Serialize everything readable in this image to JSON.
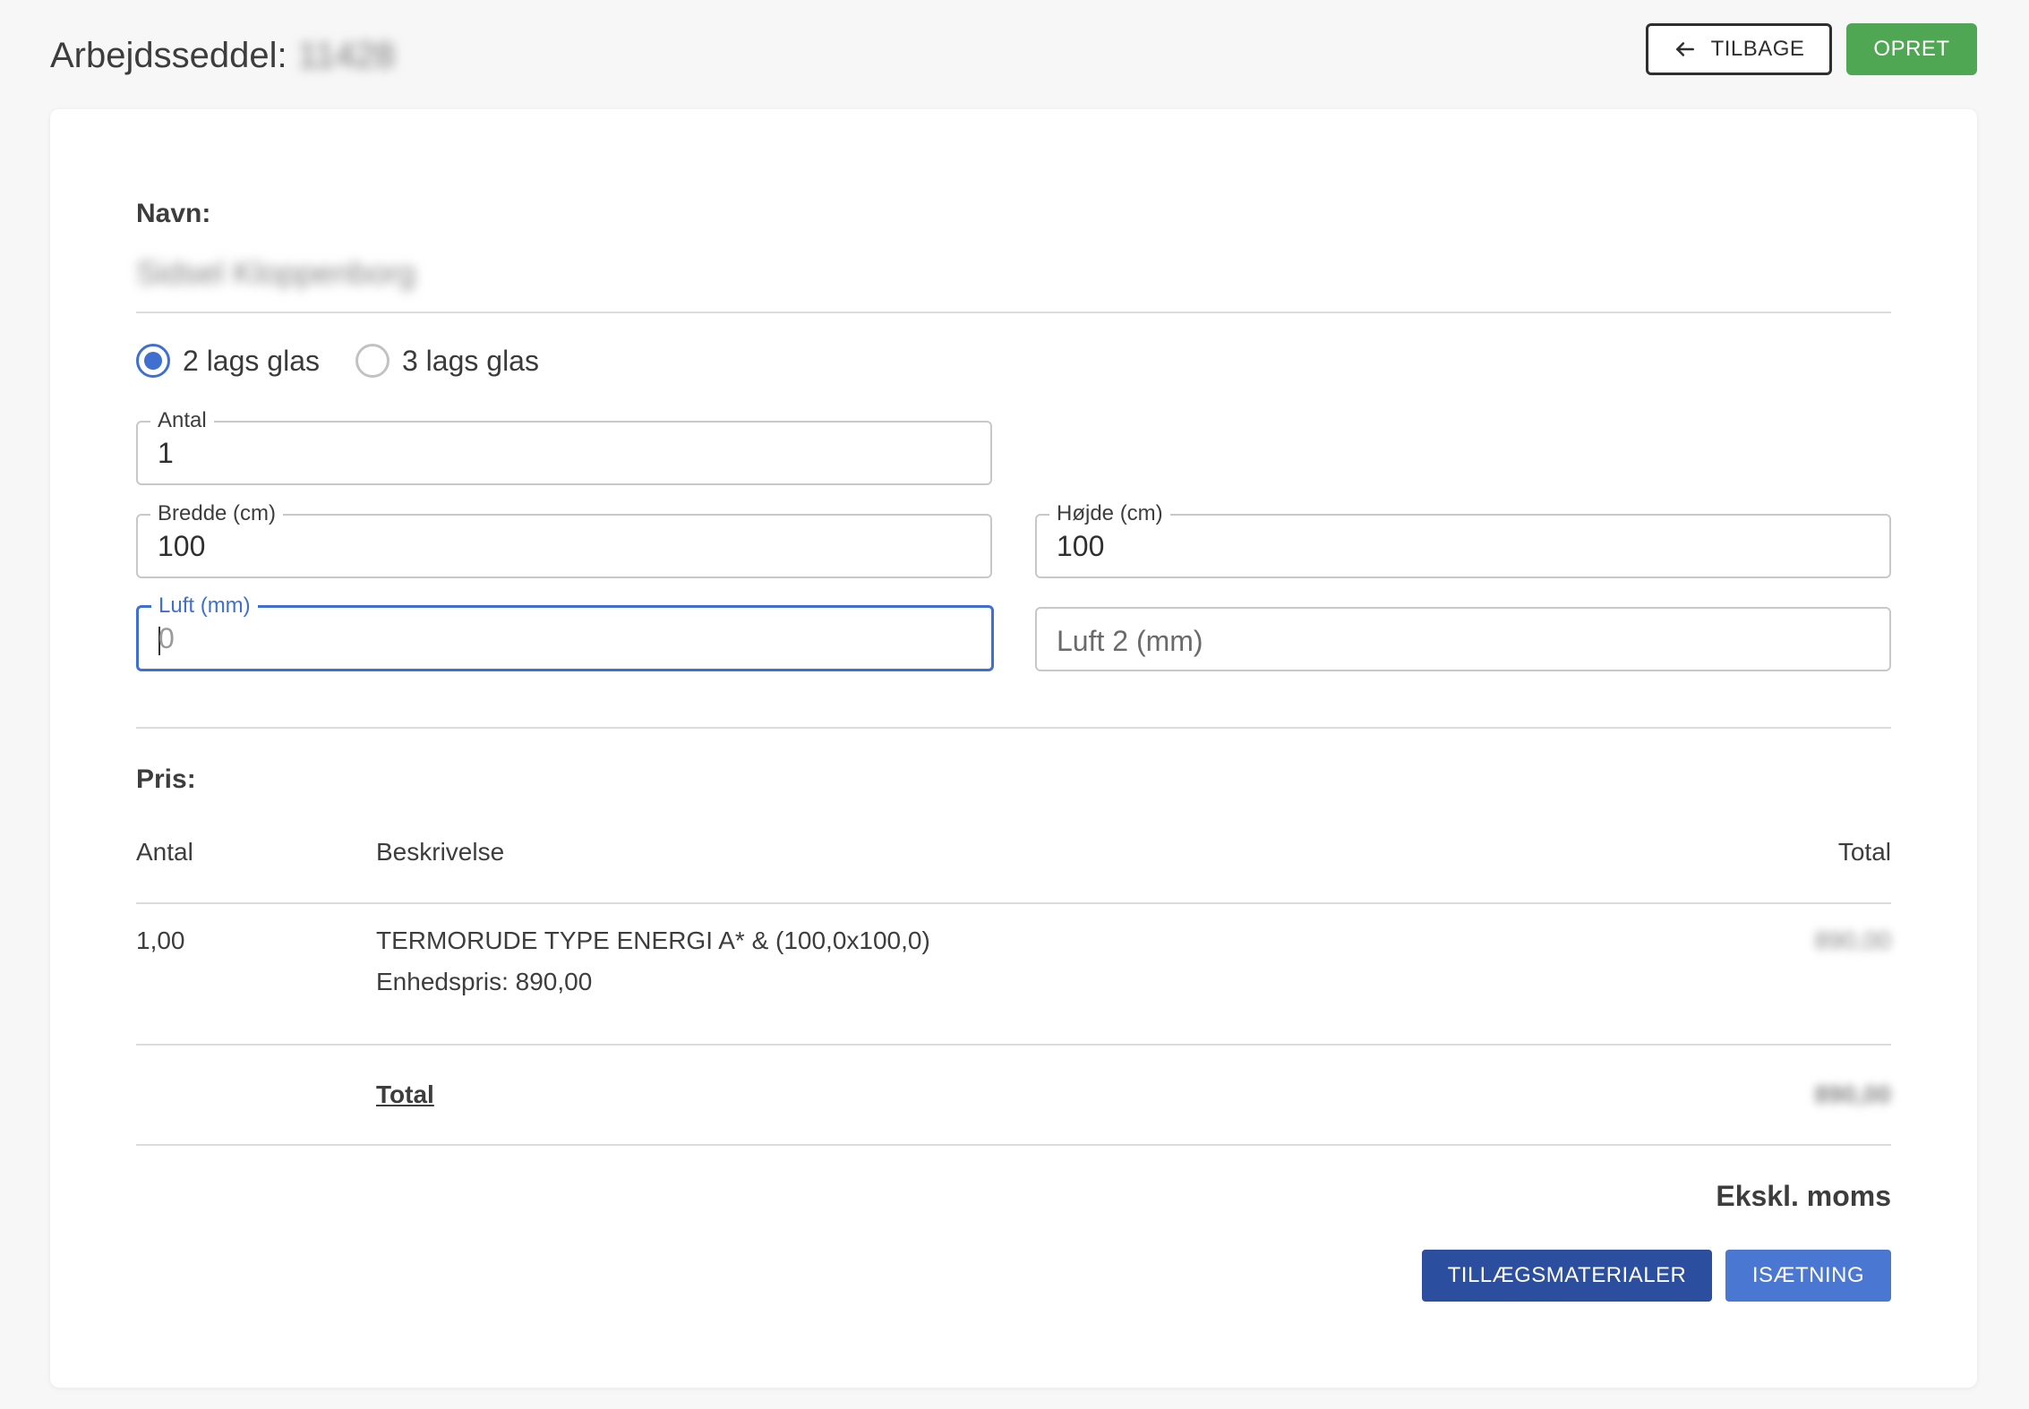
{
  "header": {
    "title_prefix": "Arbejdsseddel:",
    "title_id": "11428",
    "back_label": "TILBAGE",
    "create_label": "OPRET"
  },
  "form": {
    "name_label": "Navn:",
    "name_value": "Sidsel Kloppenborg",
    "glass_options": [
      {
        "label": "2 lags glas",
        "selected": true
      },
      {
        "label": "3 lags glas",
        "selected": false
      }
    ],
    "antal": {
      "label": "Antal",
      "value": "1"
    },
    "bredde": {
      "label": "Bredde (cm)",
      "value": "100"
    },
    "hojde": {
      "label": "Højde (cm)",
      "value": "100"
    },
    "luft": {
      "label": "Luft (mm)",
      "value": "0"
    },
    "luft2": {
      "placeholder": "Luft 2 (mm)"
    }
  },
  "price": {
    "title": "Pris:",
    "columns": {
      "antal": "Antal",
      "beskrivelse": "Beskrivelse",
      "total": "Total"
    },
    "rows": [
      {
        "antal": "1,00",
        "beskrivelse": "TERMORUDE TYPE ENERGI A* & (100,0x100,0)",
        "enhedspris": "Enhedspris: 890,00",
        "total": "890,00"
      }
    ],
    "total_label": "Total",
    "total_value": "890,00",
    "note": "Ekskl. moms"
  },
  "actions": {
    "materials_label": "TILLÆGSMATERIALER",
    "mounting_label": "ISÆTNING"
  },
  "colors": {
    "accent_blue": "#3f6fcf",
    "dark_blue": "#2b4f9e",
    "green": "#4fa653"
  }
}
